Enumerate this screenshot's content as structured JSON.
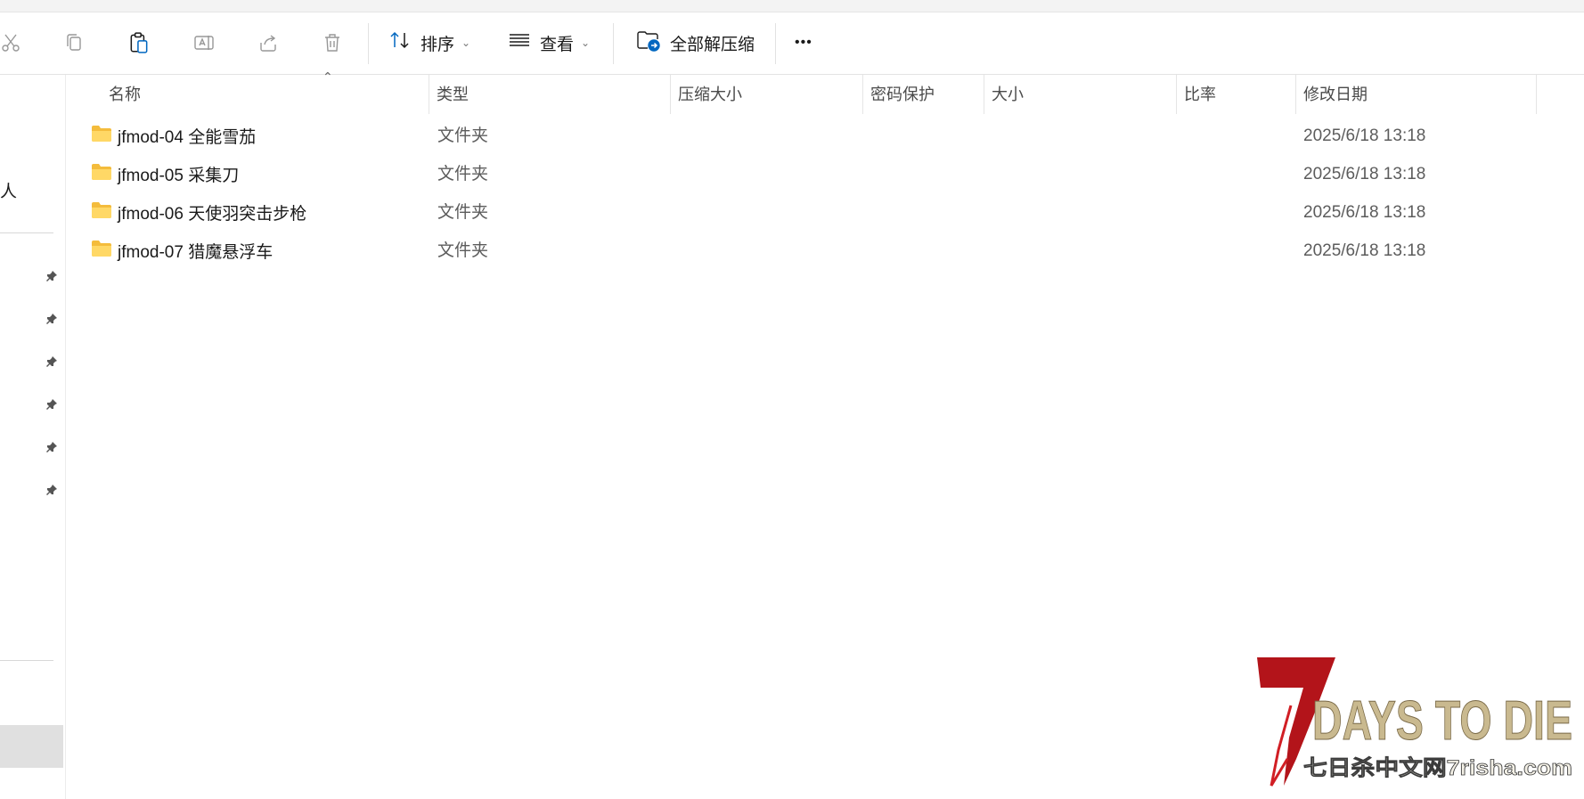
{
  "toolbar": {
    "sort_label": "排序",
    "view_label": "查看",
    "extract_label": "全部解压缩",
    "more_label": "•••"
  },
  "sidebar": {
    "partial_label": "人"
  },
  "columns": [
    "名称",
    "类型",
    "压缩大小",
    "密码保护",
    "大小",
    "比率",
    "修改日期"
  ],
  "files": [
    {
      "name": "jfmod-04 全能雪茄",
      "type": "文件夹",
      "modified": "2025/6/18 13:18"
    },
    {
      "name": "jfmod-05 采集刀",
      "type": "文件夹",
      "modified": "2025/6/18 13:18"
    },
    {
      "name": "jfmod-06 天使羽突击步枪",
      "type": "文件夹",
      "modified": "2025/6/18 13:18"
    },
    {
      "name": "jfmod-07 猎魔悬浮车",
      "type": "文件夹",
      "modified": "2025/6/18 13:18"
    }
  ],
  "watermark": {
    "title": "DAYS TO DIE",
    "numeral": "7",
    "subtitle": "七日杀中文网7risha.com"
  },
  "colors": {
    "accent": "#0067c0",
    "folder": "#f7c948",
    "logo_red": "#b3141a",
    "logo_gold": "#c9b98f"
  }
}
